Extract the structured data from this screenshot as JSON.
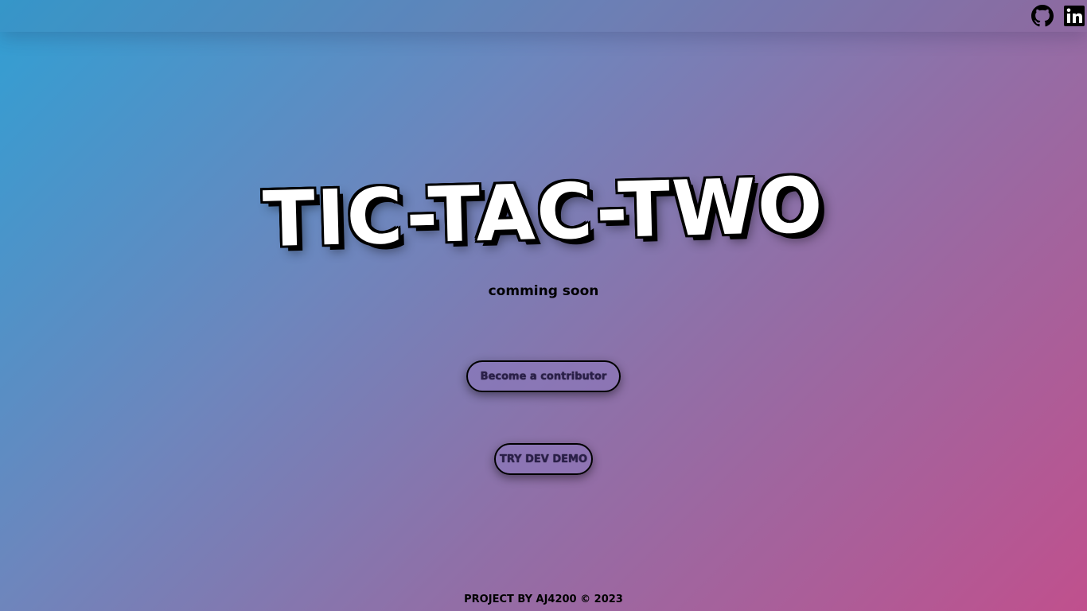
{
  "header": {
    "icons": [
      "github-icon",
      "linkedin-icon"
    ]
  },
  "hero": {
    "title": "TIC-TAC-TWO",
    "subtitle": "comming soon"
  },
  "actions": {
    "contributor_label": "Become a contributor",
    "demo_label": "TRY DEV DEMO"
  },
  "footer": {
    "text": "PROJECT BY AJ4200 © 2023"
  },
  "colors": {
    "gradient_start": "#319fd3",
    "gradient_end": "#c0508d",
    "title_fill": "#ffffff",
    "outline": "#000000"
  }
}
